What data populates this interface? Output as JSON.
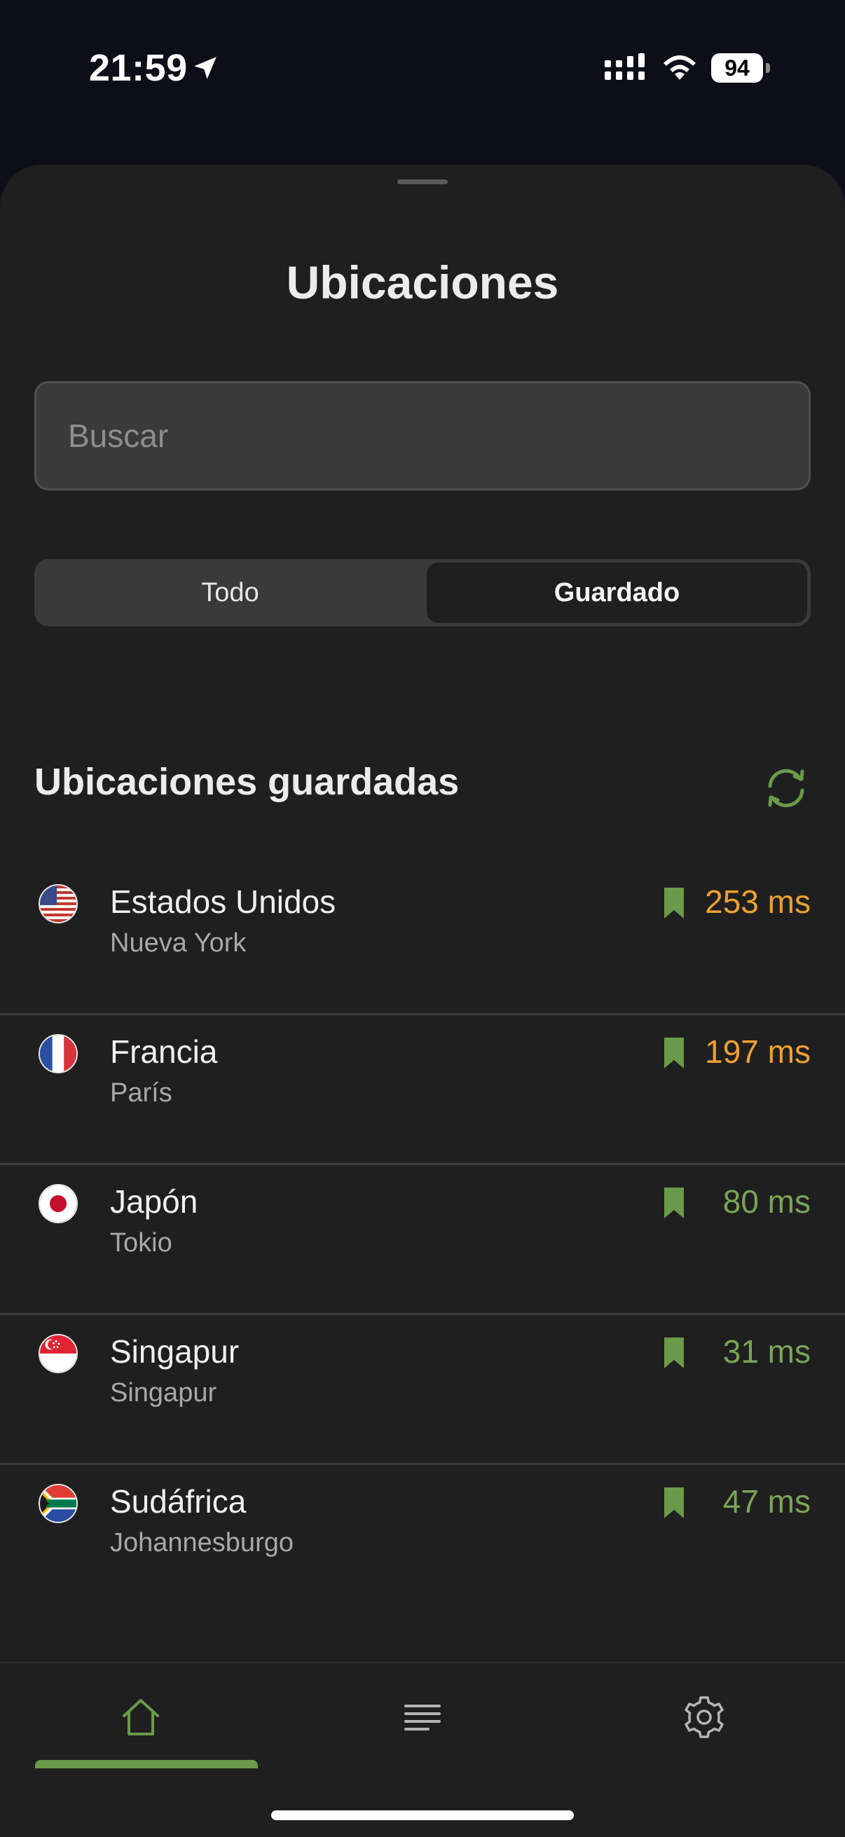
{
  "status_bar": {
    "time": "21:59",
    "battery": "94"
  },
  "sheet": {
    "title": "Ubicaciones",
    "search": {
      "placeholder": "Buscar",
      "value": ""
    },
    "segments": [
      {
        "label": "Todo",
        "selected": false
      },
      {
        "label": "Guardado",
        "selected": true
      }
    ],
    "section_title": "Ubicaciones guardadas",
    "locations": [
      {
        "country": "Estados Unidos",
        "city": "Nueva York",
        "latency": "253 ms",
        "latency_color": "#f0a030",
        "flag": "us-flag-icon"
      },
      {
        "country": "Francia",
        "city": "París",
        "latency": "197 ms",
        "latency_color": "#f0a030",
        "flag": "fr-flag-icon"
      },
      {
        "country": "Japón",
        "city": "Tokio",
        "latency": "80 ms",
        "latency_color": "#7aa556",
        "flag": "jp-flag-icon"
      },
      {
        "country": "Singapur",
        "city": "Singapur",
        "latency": "31 ms",
        "latency_color": "#7aa556",
        "flag": "sg-flag-icon"
      },
      {
        "country": "Sudáfrica",
        "city": "Johannesburgo",
        "latency": "47 ms",
        "latency_color": "#7aa556",
        "flag": "za-flag-icon"
      }
    ]
  },
  "tab_bar": {
    "tabs": [
      {
        "icon": "home-icon",
        "active": true
      },
      {
        "icon": "list-icon",
        "active": false
      },
      {
        "icon": "gear-icon",
        "active": false
      }
    ]
  },
  "colors": {
    "accent": "#6a9a4a",
    "background": "#1f1f20",
    "latency_high": "#f0a030",
    "latency_low": "#7aa556"
  }
}
